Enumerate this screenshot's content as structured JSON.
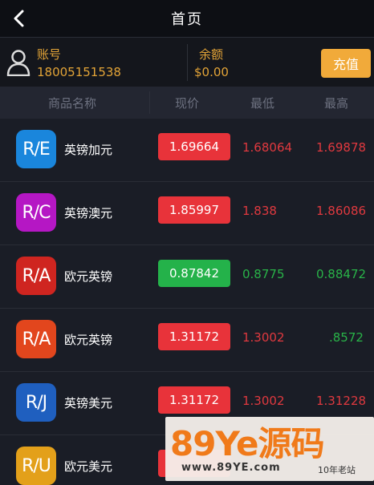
{
  "header": {
    "title": "首页"
  },
  "account": {
    "account_label": "账号",
    "account_value": "18005151538",
    "balance_label": "余额",
    "balance_value": "$0.00",
    "recharge_label": "充值"
  },
  "table": {
    "columns": [
      "商品名称",
      "现价",
      "最低",
      "最高"
    ],
    "rows": [
      {
        "badge": "R/E",
        "badge_color": "#1a86dc",
        "name": "英镑加元",
        "price": "1.69664",
        "low": "1.68064",
        "high": "1.69878",
        "trend": "down",
        "trend_color": "#e8333a"
      },
      {
        "badge": "R/C",
        "badge_color": "#b517c4",
        "name": "英镑澳元",
        "price": "1.85997",
        "low": "1.838",
        "high": "1.86086",
        "trend": "down",
        "trend_color": "#e8333a"
      },
      {
        "badge": "R/A",
        "badge_color": "#cf2520",
        "name": "欧元英镑",
        "price": "0.87842",
        "low": "0.8775",
        "high": "0.88472",
        "trend": "up",
        "trend_color": "#24b24a"
      },
      {
        "badge": "R/A",
        "badge_color": "#e2461d",
        "name": "欧元英镑",
        "price": "1.31172",
        "low": "1.3002",
        "high": ".8572",
        "trend": "down",
        "trend_color": "#e8333a"
      },
      {
        "badge": "R/J",
        "badge_color": "#1f5fbf",
        "name": "英镑美元",
        "price": "1.31172",
        "low": "1.3002",
        "high": "1.31228",
        "trend": "down",
        "trend_color": "#e8333a"
      },
      {
        "badge": "R/U",
        "badge_color": "#e3a01a",
        "name": "欧元美元",
        "price": "",
        "low": "",
        "high": "",
        "trend": "down",
        "trend_color": "#e8333a"
      }
    ]
  },
  "watermark": {
    "brand": "89Ye源码",
    "url": "www.89YE.com",
    "tag": "10年老站"
  },
  "icons": {
    "back": "back-arrow-icon",
    "avatar": "user-icon"
  }
}
